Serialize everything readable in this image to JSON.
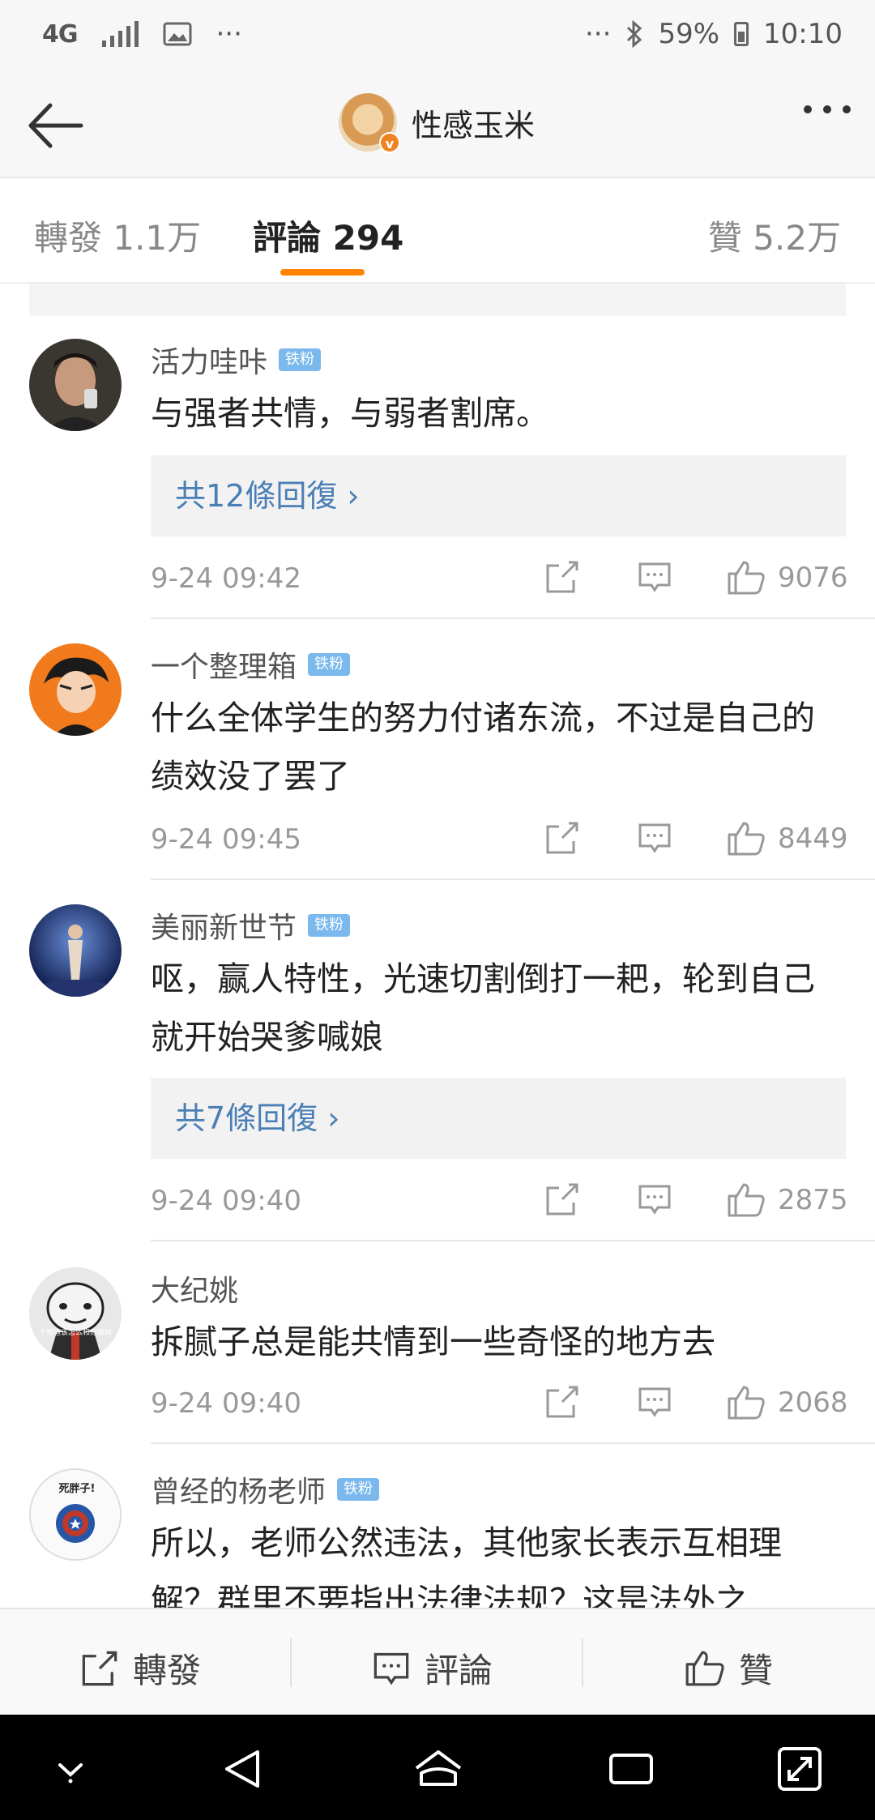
{
  "status_bar": {
    "network": "4G",
    "dots": "···",
    "right_dots": "···",
    "battery": "59%",
    "time": "10:10"
  },
  "header": {
    "title": "性感玉米",
    "verified_mark": "v"
  },
  "tabs": {
    "repost": "轉發 1.1万",
    "comments": "評論 294",
    "likes": "贊 5.2万"
  },
  "comments": [
    {
      "name": "活力哇咔",
      "badge": "铁粉",
      "text": "与强者共情，与弱者割席。",
      "replies": "共12條回復 ›",
      "time": "9-24 09:42",
      "likes": "9076"
    },
    {
      "name": "一个整理箱",
      "badge": "铁粉",
      "text": "什么全体学生的努力付诸东流，不过是自己的绩效没了罢了",
      "replies": "",
      "time": "9-24 09:45",
      "likes": "8449"
    },
    {
      "name": "美丽新世节",
      "badge": "铁粉",
      "text": "呕，赢人特性，光速切割倒打一耙，轮到自己就开始哭爹喊娘",
      "replies": "共7條回復 ›",
      "time": "9-24 09:40",
      "likes": "2875"
    },
    {
      "name": "大纪姚",
      "badge": "",
      "text": "拆腻子总是能共情到一些奇怪的地方去",
      "replies": "",
      "time": "9-24 09:40",
      "likes": "2068"
    },
    {
      "name": "曾经的杨老师",
      "badge": "铁粉",
      "text": "所以，老师公然违法，其他家长表示互相理解？群里不要指出法律法规？这是法外之",
      "replies": "",
      "time": "",
      "likes": ""
    }
  ],
  "avatar_captions": {
    "c4": "不知道该怎么和你解释",
    "c5": "死胖子!"
  },
  "bottom_bar": {
    "repost": "轉發",
    "comment": "評論",
    "like": "贊"
  },
  "colors": {
    "accent": "#ff8200",
    "link": "#4a7fb6",
    "badge": "#7ab8ed"
  },
  "icons": [
    "back-arrow-icon",
    "more-icon",
    "repost-icon",
    "comment-icon",
    "like-icon",
    "nav-down-icon",
    "nav-back-icon",
    "nav-home-icon",
    "nav-recents-icon",
    "nav-expand-icon"
  ]
}
